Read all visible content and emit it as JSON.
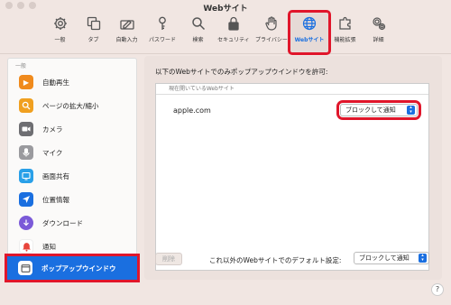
{
  "window": {
    "title": "Webサイト"
  },
  "toolbar": {
    "items": [
      {
        "label": "一般",
        "icon": "gear-icon"
      },
      {
        "label": "タブ",
        "icon": "tabs-icon"
      },
      {
        "label": "自動入力",
        "icon": "autofill-icon"
      },
      {
        "label": "パスワード",
        "icon": "key-icon"
      },
      {
        "label": "検索",
        "icon": "search-icon"
      },
      {
        "label": "セキュリティ",
        "icon": "lock-icon"
      },
      {
        "label": "プライバシー",
        "icon": "hand-icon"
      },
      {
        "label": "Webサイト",
        "icon": "globe-icon",
        "active": true
      },
      {
        "label": "機能拡張",
        "icon": "extension-icon"
      },
      {
        "label": "詳細",
        "icon": "gears-icon"
      }
    ]
  },
  "sidebar": {
    "section": "一般",
    "items": [
      {
        "label": "自動再生",
        "icon": "play-icon",
        "color": "#f08a1c"
      },
      {
        "label": "ページの拡大/縮小",
        "icon": "zoom-icon",
        "color": "#f0a020"
      },
      {
        "label": "カメラ",
        "icon": "camera-icon",
        "color": "#6e6e72"
      },
      {
        "label": "マイク",
        "icon": "microphone-icon",
        "color": "#9a9a9e"
      },
      {
        "label": "画面共有",
        "icon": "screen-share-icon",
        "color": "#2aa0e8"
      },
      {
        "label": "位置情報",
        "icon": "location-icon",
        "color": "#1a6fe0"
      },
      {
        "label": "ダウンロード",
        "icon": "download-icon",
        "color": "#7b5ad8"
      },
      {
        "label": "通知",
        "icon": "bell-icon",
        "color": "#e8453c"
      },
      {
        "label": "ポップアップウインドウ",
        "icon": "popup-window-icon",
        "color": "#ffffff",
        "selected": true
      }
    ]
  },
  "main": {
    "description": "以下のWebサイトでのみポップアップウインドウを許可:",
    "table_header": "現在開いているWebサイト",
    "rows": [
      {
        "site": "apple.com",
        "setting": "ブロックして通知"
      }
    ],
    "delete_label": "削除",
    "default_label": "これ以外のWebサイトでのデフォルト設定:",
    "default_value": "ブロックして通知"
  },
  "help": "?"
}
